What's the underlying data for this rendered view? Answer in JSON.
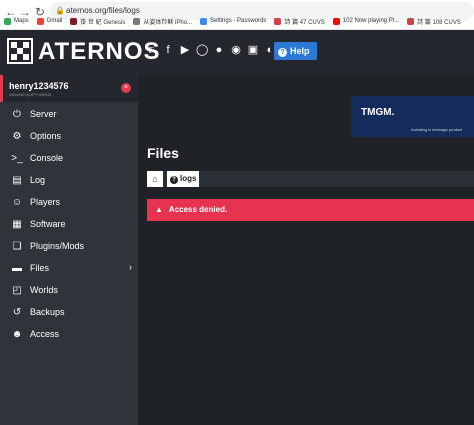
{
  "browser": {
    "url": "aternos.org/files/logs",
    "bookmarks": [
      {
        "label": "Maps",
        "color": "#34a853"
      },
      {
        "label": "Gmail",
        "color": "#ea4335"
      },
      {
        "label": "掛 世 紀 Genesis",
        "color": "#7a1f1f"
      },
      {
        "label": "从姿体羚稣 iPho...",
        "color": "#777777"
      },
      {
        "label": "Settings - Passwords",
        "color": "#4285f4"
      },
      {
        "label": "詩 篇 47 CUVS",
        "color": "#c44"
      },
      {
        "label": "102 Now playing Pl...",
        "color": "#ff0000"
      },
      {
        "label": "詩 篇 108 CUVS",
        "color": "#c44"
      }
    ]
  },
  "header": {
    "brand": "ATERNOS",
    "help_label": "Help",
    "socials": [
      "twitter-icon",
      "facebook-icon",
      "youtube-icon",
      "instagram-icon",
      "reddit-icon",
      "discord-icon",
      "chat-icon",
      "github-icon"
    ]
  },
  "user": {
    "name": "henry1234576",
    "id": "#5bmNEVyUP7Y8IRk5I"
  },
  "menu": [
    {
      "label": "Server",
      "icon": "power-icon"
    },
    {
      "label": "Options",
      "icon": "gear-icon"
    },
    {
      "label": "Console",
      "icon": "terminal-icon"
    },
    {
      "label": "Log",
      "icon": "log-icon"
    },
    {
      "label": "Players",
      "icon": "users-icon"
    },
    {
      "label": "Software",
      "icon": "cube-icon"
    },
    {
      "label": "Plugins/Mods",
      "icon": "puzzle-icon"
    },
    {
      "label": "Files",
      "icon": "folder-icon"
    },
    {
      "label": "Worlds",
      "icon": "globe-icon"
    },
    {
      "label": "Backups",
      "icon": "backup-icon"
    },
    {
      "label": "Access",
      "icon": "user-lock-icon"
    }
  ],
  "ad": {
    "brand": "TMGM.",
    "tagline": "Investing in leverage product"
  },
  "main": {
    "title": "Files",
    "breadcrumb_logs": "logs",
    "alert": "Access denied."
  },
  "colors": {
    "accent": "#2d7ad6",
    "danger": "#e53350"
  }
}
